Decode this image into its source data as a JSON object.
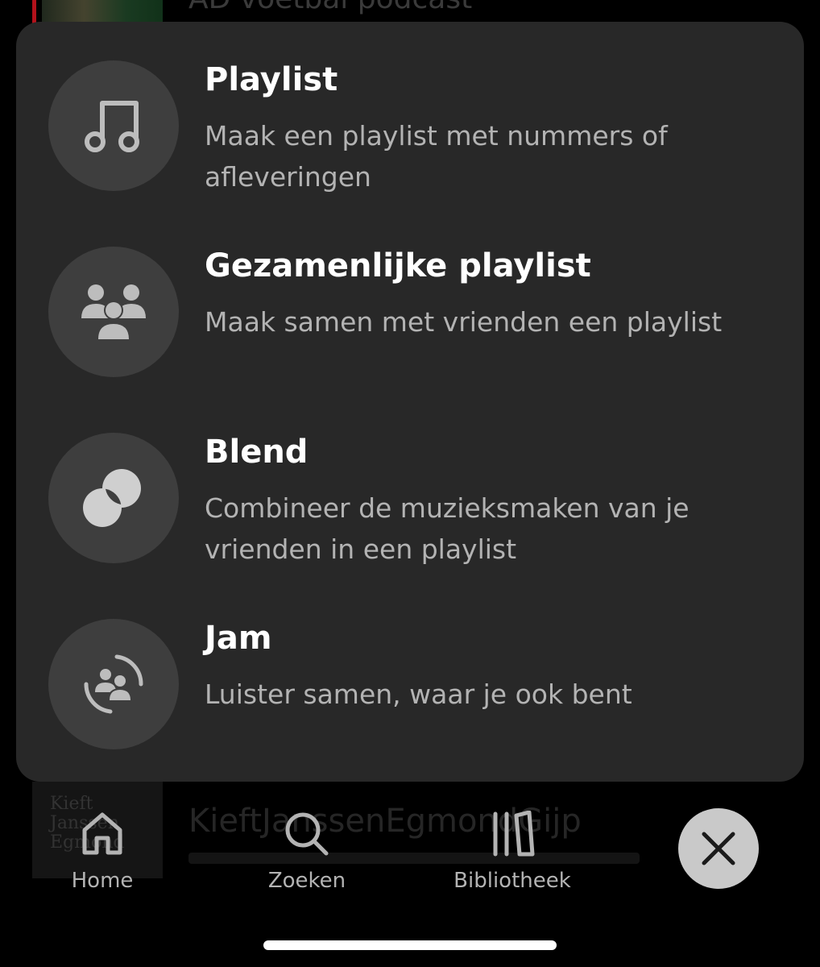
{
  "background": {
    "top_item_title": "AD voetbal podcast",
    "bottom_item_title": "KieftJanssenEgmondGijp",
    "bottom_item_thumb_text": "Kieft Janssen Egmond"
  },
  "create_menu": {
    "options": [
      {
        "icon": "music-note-icon",
        "title": "Playlist",
        "description": "Maak een playlist met nummers of afleveringen"
      },
      {
        "icon": "people-group-icon",
        "title": "Gezamenlijke playlist",
        "description": "Maak samen met vrienden een playlist"
      },
      {
        "icon": "blend-circles-icon",
        "title": "Blend",
        "description": "Combineer de muzieksmaken van je vrienden in een playlist"
      },
      {
        "icon": "jam-icon",
        "title": "Jam",
        "description": "Luister samen, waar je ook bent"
      }
    ]
  },
  "nav": {
    "items": [
      {
        "label": "Home",
        "icon": "home-icon"
      },
      {
        "label": "Zoeken",
        "icon": "search-icon"
      },
      {
        "label": "Bibliotheek",
        "icon": "library-icon"
      }
    ],
    "close_icon": "close-icon"
  },
  "colors": {
    "sheet_background": "#282828",
    "icon_circle": "#3e3e3e",
    "title_text": "#ffffff",
    "description_text": "#b3b3b3",
    "close_button": "#c9c9c9"
  }
}
